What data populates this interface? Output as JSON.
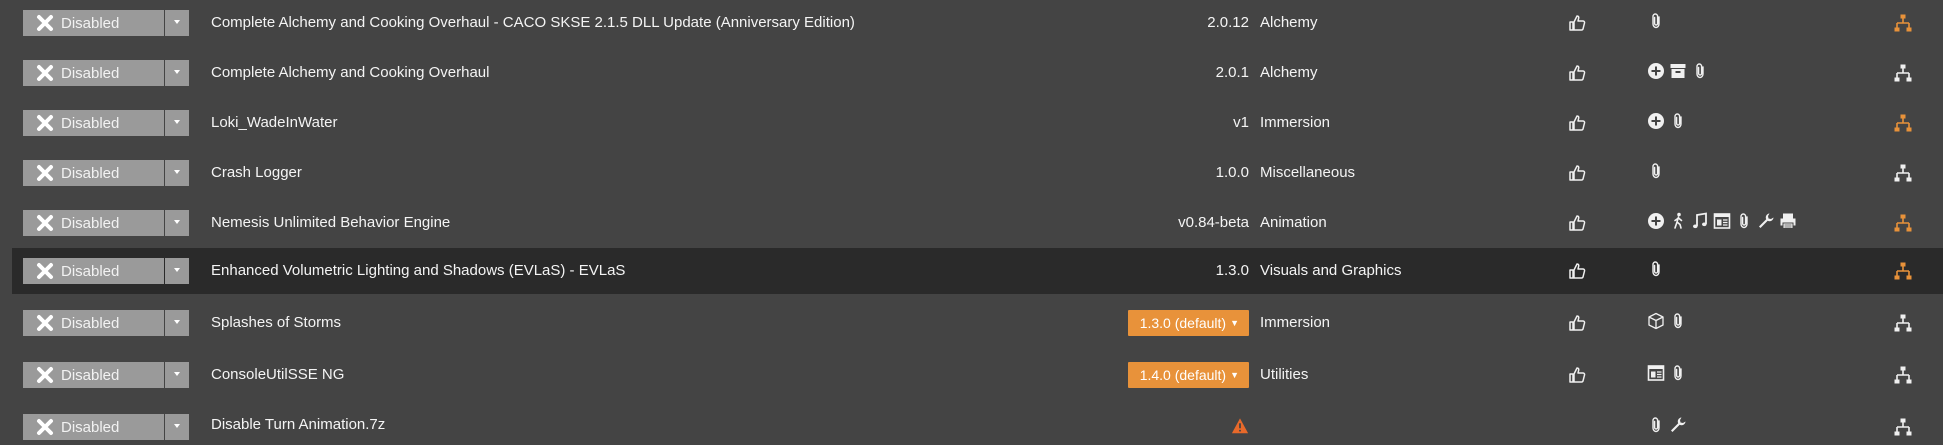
{
  "colors": {
    "background": "#444444",
    "selected_row": "#2a2a2a",
    "status_button": "#9a9a9a",
    "accent_orange": "#e8923a",
    "icon_white": "#f0f0f0"
  },
  "mods": [
    {
      "status": "Disabled",
      "name": "Complete Alchemy and Cooking Overhaul - CACO SKSE 2.1.5 DLL Update (Anniversary Edition)",
      "version": "2.0.12",
      "version_style": "text",
      "category": "Alchemy",
      "flags": [
        "paperclip-icon"
      ],
      "tree_color": "orange"
    },
    {
      "status": "Disabled",
      "name": "Complete Alchemy and Cooking Overhaul",
      "version": "2.0.1",
      "version_style": "text",
      "category": "Alchemy",
      "flags": [
        "plus-circle-icon",
        "archive-icon",
        "paperclip-icon"
      ],
      "tree_color": "white"
    },
    {
      "status": "Disabled",
      "name": "Loki_WadeInWater",
      "version": "v1",
      "version_style": "text",
      "category": "Immersion",
      "flags": [
        "plus-circle-icon",
        "paperclip-icon"
      ],
      "tree_color": "orange"
    },
    {
      "status": "Disabled",
      "name": "Crash Logger",
      "version": "1.0.0",
      "version_style": "text",
      "category": "Miscellaneous",
      "flags": [
        "paperclip-icon"
      ],
      "tree_color": "white"
    },
    {
      "status": "Disabled",
      "name": "Nemesis Unlimited Behavior Engine",
      "version": "v0.84-beta",
      "version_style": "text",
      "category": "Animation",
      "flags": [
        "plus-circle-icon",
        "walking-figure-icon",
        "music-note-icon",
        "window-icon",
        "paperclip-icon",
        "wrench-icon",
        "printer-icon"
      ],
      "tree_color": "orange"
    },
    {
      "status": "Disabled",
      "name": "Enhanced Volumetric Lighting and Shadows (EVLaS) - EVLaS",
      "version": "1.3.0",
      "version_style": "text",
      "category": "Visuals and Graphics",
      "flags": [
        "paperclip-icon"
      ],
      "tree_color": "orange",
      "selected": true
    },
    {
      "status": "Disabled",
      "name": "Splashes of Storms",
      "version": "1.3.0 (default)",
      "version_style": "button",
      "category": "Immersion",
      "flags": [
        "cube-icon",
        "paperclip-icon"
      ],
      "tree_color": "white"
    },
    {
      "status": "Disabled",
      "name": "ConsoleUtilSSE NG",
      "version": "1.4.0 (default)",
      "version_style": "button",
      "category": "Utilities",
      "flags": [
        "window-icon",
        "paperclip-icon"
      ],
      "tree_color": "white"
    },
    {
      "status": "Disabled",
      "name": "Disable Turn Animation.7z",
      "version": "",
      "version_style": "warning",
      "category": "",
      "flags": [
        "paperclip-icon",
        "wrench-icon"
      ],
      "tree_color": "white"
    }
  ]
}
